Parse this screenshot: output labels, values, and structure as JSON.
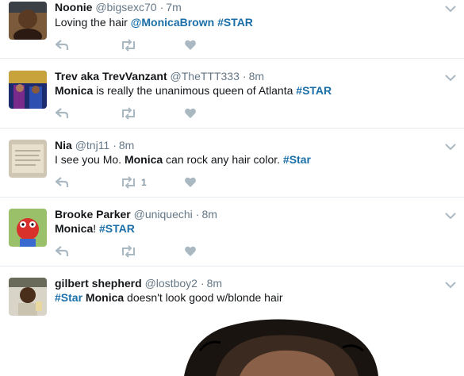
{
  "colors": {
    "link": "#1b6fa8",
    "muted": "#657786",
    "icon": "#aab8c2",
    "divider": "#e6ecf0"
  },
  "tweets": [
    {
      "fullname": "Noonie",
      "handle": "@bigsexc70",
      "time": "7m",
      "text": [
        {
          "t": "Loving the hair ",
          "k": "plain"
        },
        {
          "t": "@MonicaBrown",
          "k": "mention"
        },
        {
          "t": " ",
          "k": "plain"
        },
        {
          "t": "#STAR",
          "k": "hashtag"
        }
      ],
      "retweet_count": "",
      "avatar_icon": "avatar-photo"
    },
    {
      "fullname": "Trev aka TrevVanzant",
      "handle": "@TheTTT333",
      "time": "8m",
      "text": [
        {
          "t": "Monica",
          "k": "bold"
        },
        {
          "t": " is really the unanimous queen of Atlanta ",
          "k": "plain"
        },
        {
          "t": "#STAR",
          "k": "hashtag"
        }
      ],
      "retweet_count": "",
      "avatar_icon": "avatar-photo"
    },
    {
      "fullname": "Nia",
      "handle": "@tnj11",
      "time": "8m",
      "text": [
        {
          "t": "I see you Mo. ",
          "k": "plain"
        },
        {
          "t": "Monica",
          "k": "bold"
        },
        {
          "t": " can rock any hair color. ",
          "k": "plain"
        },
        {
          "t": "#Star",
          "k": "hashtag"
        }
      ],
      "retweet_count": "1",
      "avatar_icon": "avatar-photo"
    },
    {
      "fullname": "Brooke Parker",
      "handle": "@uniquechi",
      "time": "8m",
      "text": [
        {
          "t": "Monica",
          "k": "bold"
        },
        {
          "t": "! ",
          "k": "plain"
        },
        {
          "t": "#STAR",
          "k": "hashtag"
        }
      ],
      "retweet_count": "",
      "avatar_icon": "avatar-photo"
    },
    {
      "fullname": "gilbert shepherd",
      "handle": "@lostboy2",
      "time": "8m",
      "text": [
        {
          "t": "#Star",
          "k": "hashtag"
        },
        {
          "t": " ",
          "k": "plain"
        },
        {
          "t": "Monica",
          "k": "bold"
        },
        {
          "t": " doesn't look good w/blonde hair",
          "k": "plain"
        }
      ],
      "retweet_count": "",
      "avatar_icon": "avatar-photo"
    }
  ]
}
